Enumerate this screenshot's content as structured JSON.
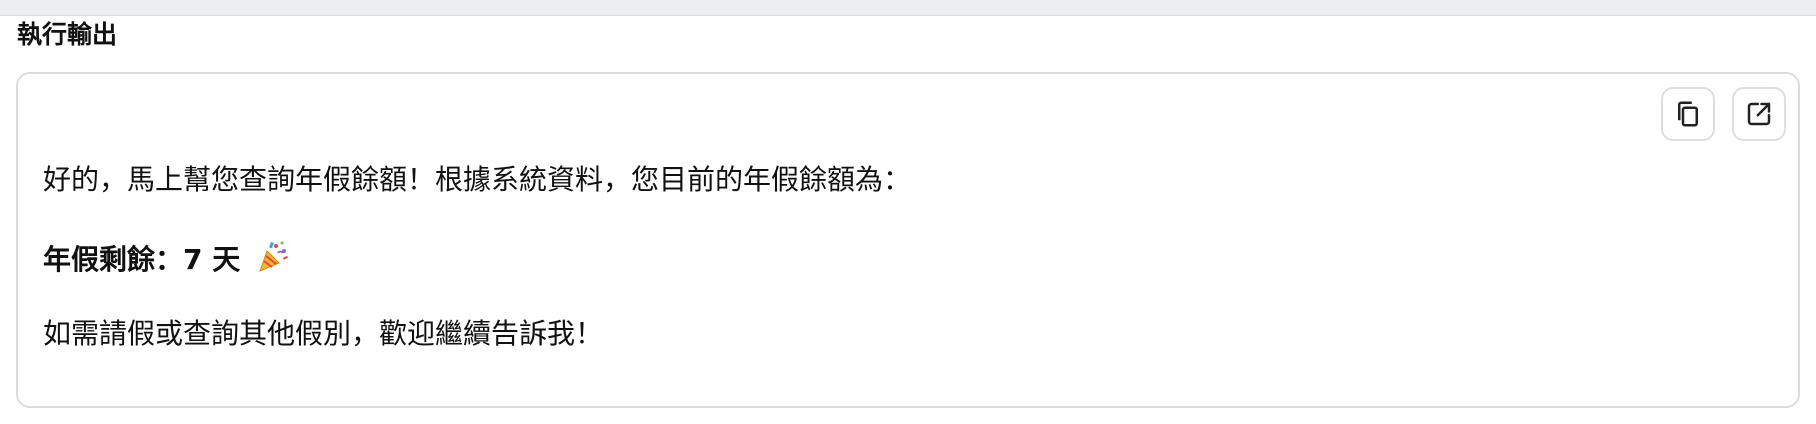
{
  "section": {
    "title": "執行輸出"
  },
  "output": {
    "line1": "好的，馬上幫您查詢年假餘額！根據系統資料，您目前的年假餘額為：",
    "line2": "年假剩餘：7 天",
    "line2_emoji": "party-popper",
    "line3": "如需請假或查詢其他假別，歡迎繼續告訴我！"
  },
  "actions": {
    "copy_icon": "copy-icon",
    "open_icon": "open-external-icon"
  }
}
